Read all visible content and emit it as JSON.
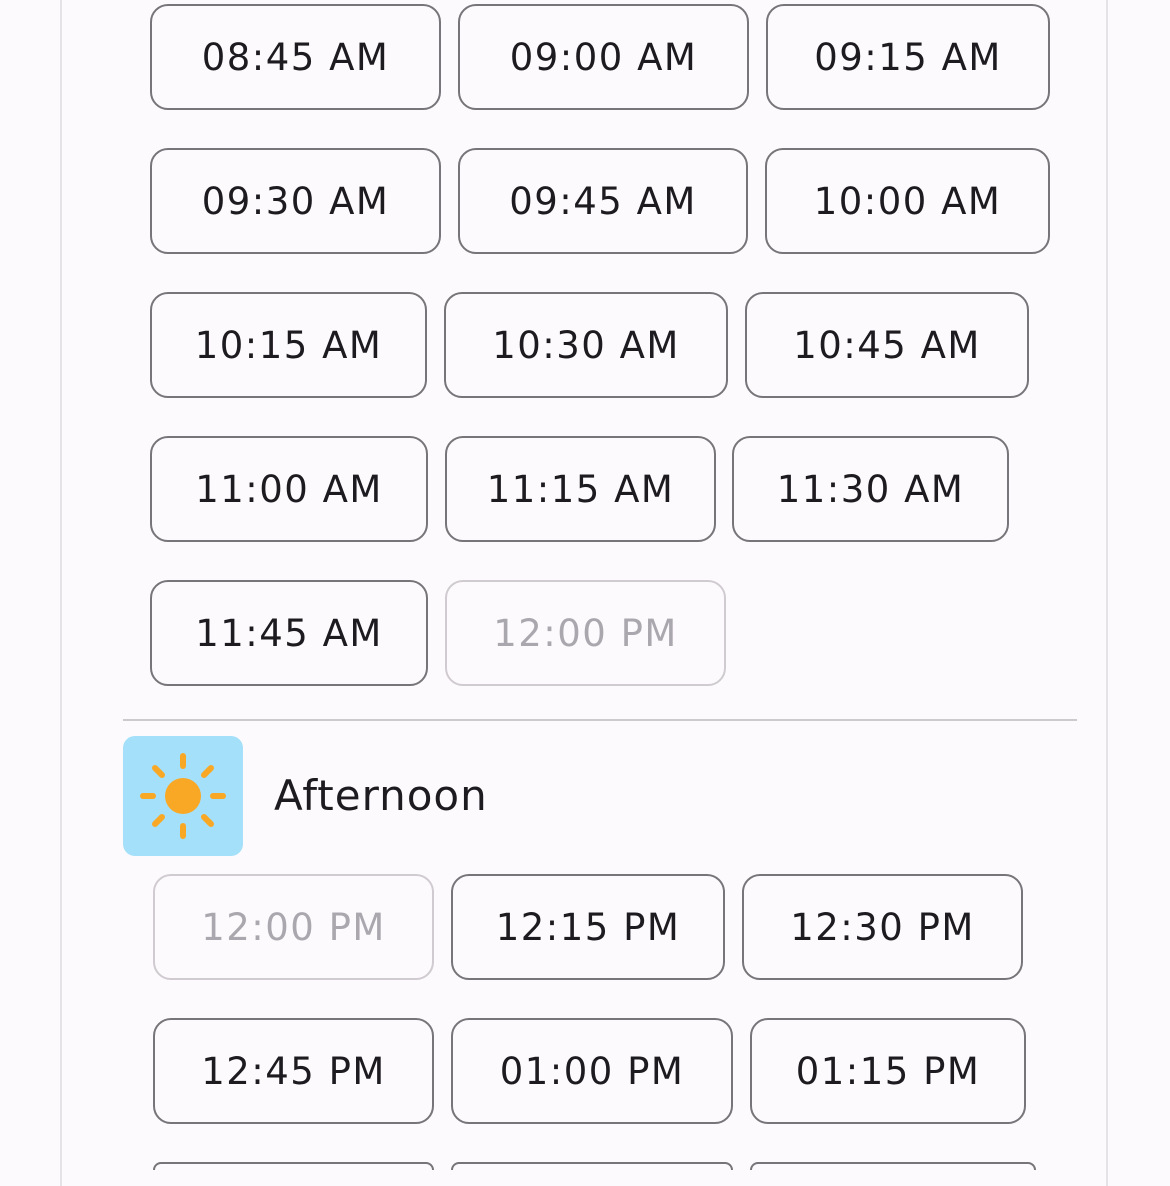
{
  "morning": {
    "slots": [
      {
        "label": "08:45 AM",
        "disabled": false
      },
      {
        "label": "09:00 AM",
        "disabled": false
      },
      {
        "label": "09:15 AM",
        "disabled": false
      },
      {
        "label": "09:30 AM",
        "disabled": false
      },
      {
        "label": "09:45 AM",
        "disabled": false
      },
      {
        "label": "10:00 AM",
        "disabled": false
      },
      {
        "label": "10:15 AM",
        "disabled": false
      },
      {
        "label": "10:30 AM",
        "disabled": false
      },
      {
        "label": "10:45 AM",
        "disabled": false
      },
      {
        "label": "11:00 AM",
        "disabled": false
      },
      {
        "label": "11:15 AM",
        "disabled": false
      },
      {
        "label": "11:30 AM",
        "disabled": false
      },
      {
        "label": "11:45 AM",
        "disabled": false
      },
      {
        "label": "12:00 PM",
        "disabled": true
      }
    ]
  },
  "afternoon": {
    "title": "Afternoon",
    "icon": "sun-icon",
    "icon_bg": "#a4e0fa",
    "slots": [
      {
        "label": "12:00 PM",
        "disabled": true
      },
      {
        "label": "12:15 PM",
        "disabled": false
      },
      {
        "label": "12:30 PM",
        "disabled": false
      },
      {
        "label": "12:45 PM",
        "disabled": false
      },
      {
        "label": "01:00 PM",
        "disabled": false
      },
      {
        "label": "01:15 PM",
        "disabled": false
      }
    ]
  },
  "colors": {
    "slot_border": "#77747a",
    "slot_border_disabled": "#cfcbd1",
    "text": "#1e1b20",
    "text_disabled": "#aba7ae",
    "sun": "#f9a825"
  }
}
